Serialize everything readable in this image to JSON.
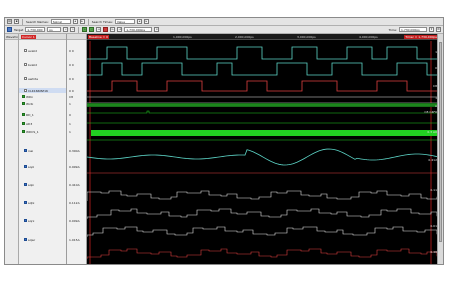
{
  "toolbar": {
    "search_names_label": "Search Names:",
    "search_names_value": "Signal",
    "search_times_label": "Search Times:",
    "search_times_value": "Value",
    "target_label": "Target",
    "target_value": "1,730,000",
    "unit_value": "ps",
    "step_value": "1,730,000ps",
    "time_label": "Time:",
    "time_value": "1,730,000ps"
  },
  "tree": {
    "header": "Waveform 1"
  },
  "names_header": {
    "label": "Cursor 1"
  },
  "signals": [
    {
      "name": "avalid",
      "value": "0 0"
    },
    {
      "name": "bvalid",
      "value": "0 0"
    },
    {
      "name": "awhite",
      "value": "0 0"
    },
    {
      "name": "CLK166MZ16",
      "value": "0 0"
    },
    {
      "name": "WDn",
      "value": "C8"
    },
    {
      "name": "Wclk",
      "value": "1"
    },
    {
      "name": "RD_1",
      "value": "0"
    },
    {
      "name": "AD3",
      "value": "1"
    },
    {
      "name": "WDCS_1",
      "value": "1"
    },
    {
      "name": "rssi",
      "value": "0.300A"
    },
    {
      "name": "sqol",
      "value": "0.999A"
    },
    {
      "name": "sqin",
      "value": "0.410A"
    },
    {
      "name": "sqtx",
      "value": "0.112A"
    },
    {
      "name": "sqrx",
      "value": "0.009A"
    },
    {
      "name": "sqwr",
      "value": "1.015A"
    }
  ],
  "wave": {
    "cursor_left": "Baseline = 0",
    "cursor_right": "Timer = 1,730,000ps",
    "ticks": [
      "1,000,000ps",
      "2,000,000ps",
      "3,000,000ps",
      "4,000,000ps"
    ],
    "right_values": [
      "1",
      "0",
      "C8",
      "1",
      "A",
      "C8 C4F0",
      "0.3 A0",
      "0.412",
      "0.11",
      "0.01",
      "0.48"
    ]
  },
  "colors": {
    "trace_teal": "#5dd6c8",
    "trace_red": "#e04040",
    "trace_green": "#22d022",
    "trace_white": "#e6e6e6",
    "cursor_red": "#c21d1d"
  }
}
